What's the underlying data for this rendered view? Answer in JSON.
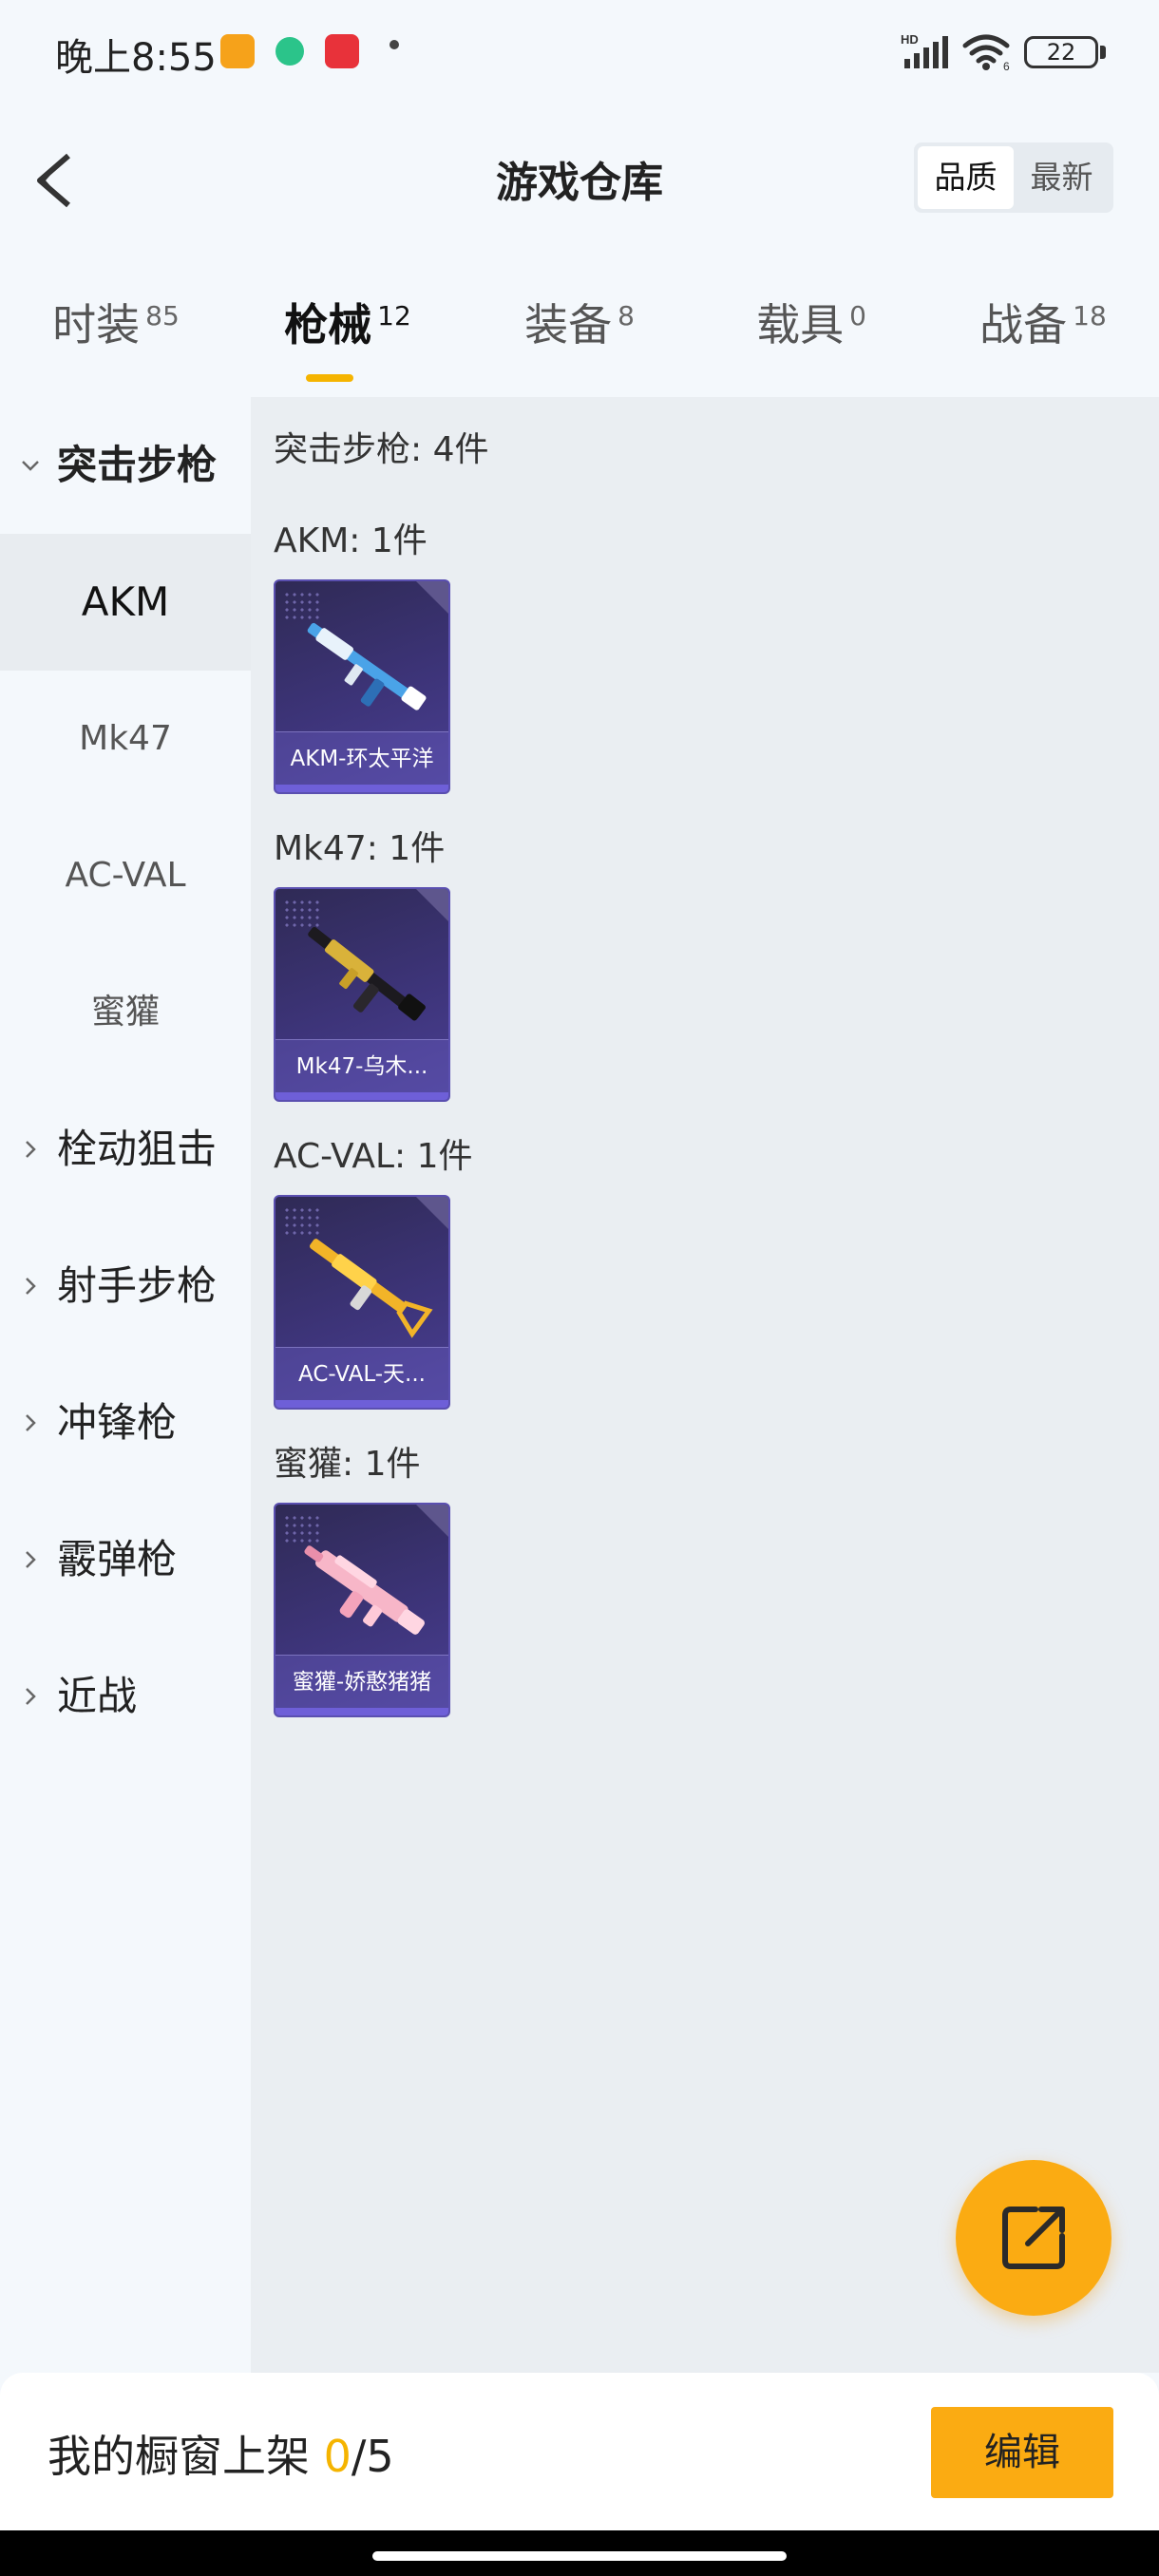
{
  "status_bar": {
    "time": "晚上8:55",
    "battery": "22",
    "network": "HD"
  },
  "header": {
    "title": "游戏仓库",
    "sort_options": [
      "品质",
      "最新"
    ],
    "sort_selected": "品质"
  },
  "tabs": [
    {
      "label": "时装",
      "count": "85"
    },
    {
      "label": "枪械",
      "count": "12",
      "active": true
    },
    {
      "label": "装备",
      "count": "8"
    },
    {
      "label": "载具",
      "count": "0"
    },
    {
      "label": "战备",
      "count": "18"
    }
  ],
  "sidebar": {
    "categories": [
      {
        "label": "突击步枪",
        "expanded": true
      },
      {
        "label": "栓动狙击"
      },
      {
        "label": "射手步枪"
      },
      {
        "label": "冲锋枪"
      },
      {
        "label": "霰弹枪"
      },
      {
        "label": "近战"
      }
    ],
    "subitems": [
      {
        "label": "AKM",
        "active": true
      },
      {
        "label": "Mk47"
      },
      {
        "label": "AC-VAL"
      },
      {
        "label": "蜜獾"
      }
    ]
  },
  "content": {
    "section_header": "突击步枪: 4件",
    "groups": [
      {
        "header": "AKM: 1件",
        "item": {
          "name": "AKM-环太平洋",
          "icon": "rifle-blue-skin"
        }
      },
      {
        "header": "Mk47: 1件",
        "item": {
          "name": "Mk47-乌木...",
          "icon": "rifle-black-gold-skin"
        }
      },
      {
        "header": "AC-VAL: 1件",
        "item": {
          "name": "AC-VAL-天...",
          "icon": "rifle-gold-skin"
        }
      },
      {
        "header": "蜜獾: 1件",
        "item": {
          "name": "蜜獾-娇憨猪猪",
          "icon": "rifle-pink-skin"
        }
      }
    ]
  },
  "fab": {
    "icon": "share-external-icon"
  },
  "bottom_bar": {
    "label": "我的橱窗上架",
    "current": "0",
    "total": "/5",
    "edit_label": "编辑"
  },
  "colors": {
    "accent": "#fbab12",
    "accent_text": "#f5b400",
    "card_bg": "#3d3479",
    "content_bg": "#eaeef2",
    "sidebar_bg": "#f4f8fc"
  }
}
